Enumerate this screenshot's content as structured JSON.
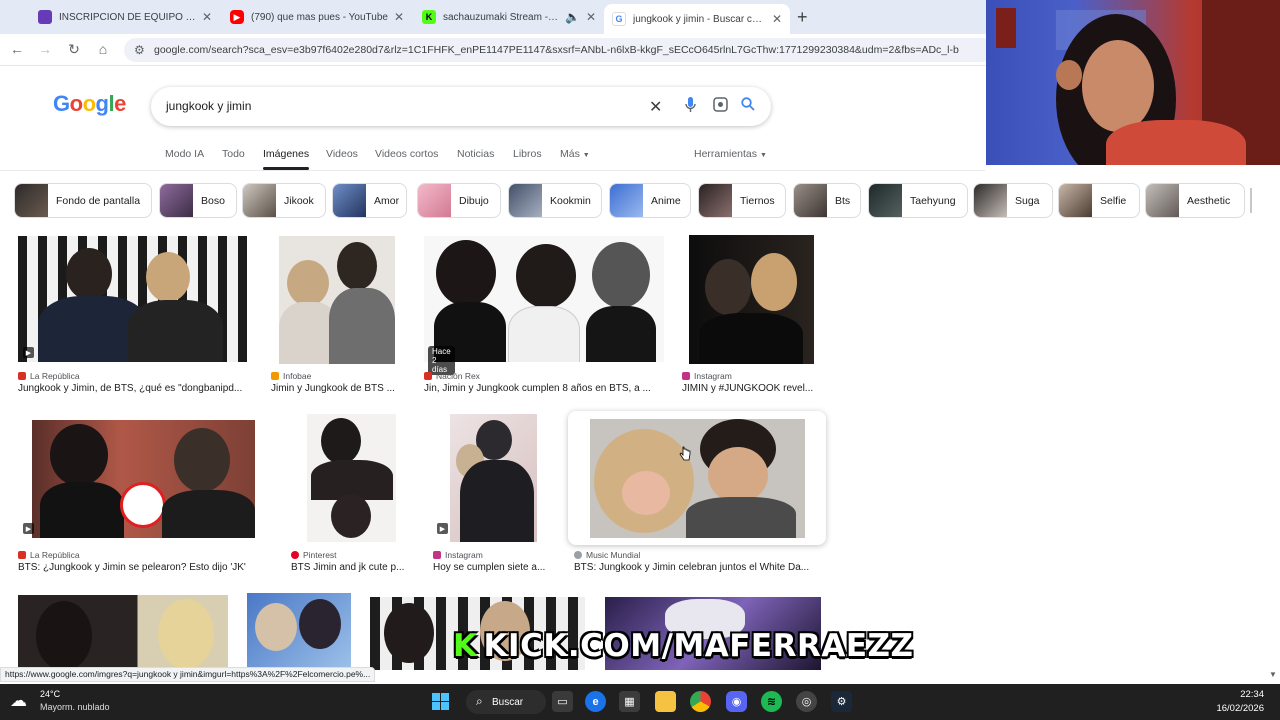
{
  "browser": {
    "tabs": [
      {
        "title": "INSCRIPCION DE EQUIPO TORI",
        "favicon_color": "#673ab7",
        "active": false
      },
      {
        "title": "(790) que mas pues - YouTube",
        "favicon_color": "#ff0000",
        "active": false
      },
      {
        "title": "sachauzumaki Stream - Wat",
        "favicon_color": "#53fc18",
        "active": false
      },
      {
        "title": "jungkook y jimin - Buscar con G",
        "favicon_color": "#4285f4",
        "active": true
      }
    ],
    "new_tab_label": "+",
    "url": "google.com/search?sca_esv=e3b97f6402e280d7&rlz=1C1FHFK_enPE1147PE1147&sxsrf=ANbL-n6lxB-kkgF_sECcO645rlnL7GcThw:1771299230384&udm=2&fbs=ADc_l-b"
  },
  "google": {
    "logo": [
      "G",
      "o",
      "o",
      "g",
      "l",
      "e"
    ],
    "query": "jungkook y jimin",
    "tabs": [
      "Modo IA",
      "Todo",
      "Imágenes",
      "Videos",
      "Videos cortos",
      "Noticias",
      "Libros",
      "Más"
    ],
    "tools": "Herramientas",
    "chips": [
      "Fondo de pantalla",
      "Boso",
      "Jikook",
      "Amor",
      "Dibujo",
      "Kookmin",
      "Anime",
      "Tiernos",
      "Bts",
      "Taehyung",
      "Suga",
      "Selfie",
      "Aesthetic"
    ]
  },
  "results": [
    {
      "source": "La República",
      "caption": "Jungkook y Jimin, de BTS, ¿qué es \"dongbanipd...",
      "source_color": "#d93025",
      "video": true
    },
    {
      "source": "Infobae",
      "caption": "Jimin y Jungkook de BTS ...",
      "source_color": "#f29900",
      "video": false
    },
    {
      "source": "Nación Rex",
      "caption": "Jin, Jimin y Jungkook cumplen 8 años en BTS, a ...",
      "source_color": "#d93025",
      "video": false,
      "badge": "Hace 2 días"
    },
    {
      "source": "Instagram",
      "caption": "JIMIN y #JUNGKOOK revel...",
      "source_color": "#c13584",
      "video": false
    },
    {
      "source": "La República",
      "caption": "BTS: ¿Jungkook y Jimin se pelearon? Esto dijo 'JK'",
      "source_color": "#d93025",
      "video": true
    },
    {
      "source": "Pinterest",
      "caption": "BTS Jimin and jk cute p...",
      "source_color": "#e60023",
      "video": false
    },
    {
      "source": "Instagram",
      "caption": "Hoy se cumplen siete a...",
      "source_color": "#c13584",
      "video": true
    },
    {
      "source": "Music Mundial",
      "caption": "BTS: Jungkook y Jimin celebran juntos el White Da...",
      "source_color": "#9aa0a6",
      "video": false
    }
  ],
  "overlay": {
    "kick_k": "K",
    "text": "KICK.COM/MAFERRAEZZ"
  },
  "status_url": "https://www.google.com/imgres?q=jungkook y jimin&imgurl=https%3A%2F%2Felcomercio.pe%...",
  "taskbar": {
    "temp": "24°C",
    "weather": "Mayorm. nublado",
    "search": "Buscar",
    "time": "22:34",
    "date": "16/02/2026"
  }
}
